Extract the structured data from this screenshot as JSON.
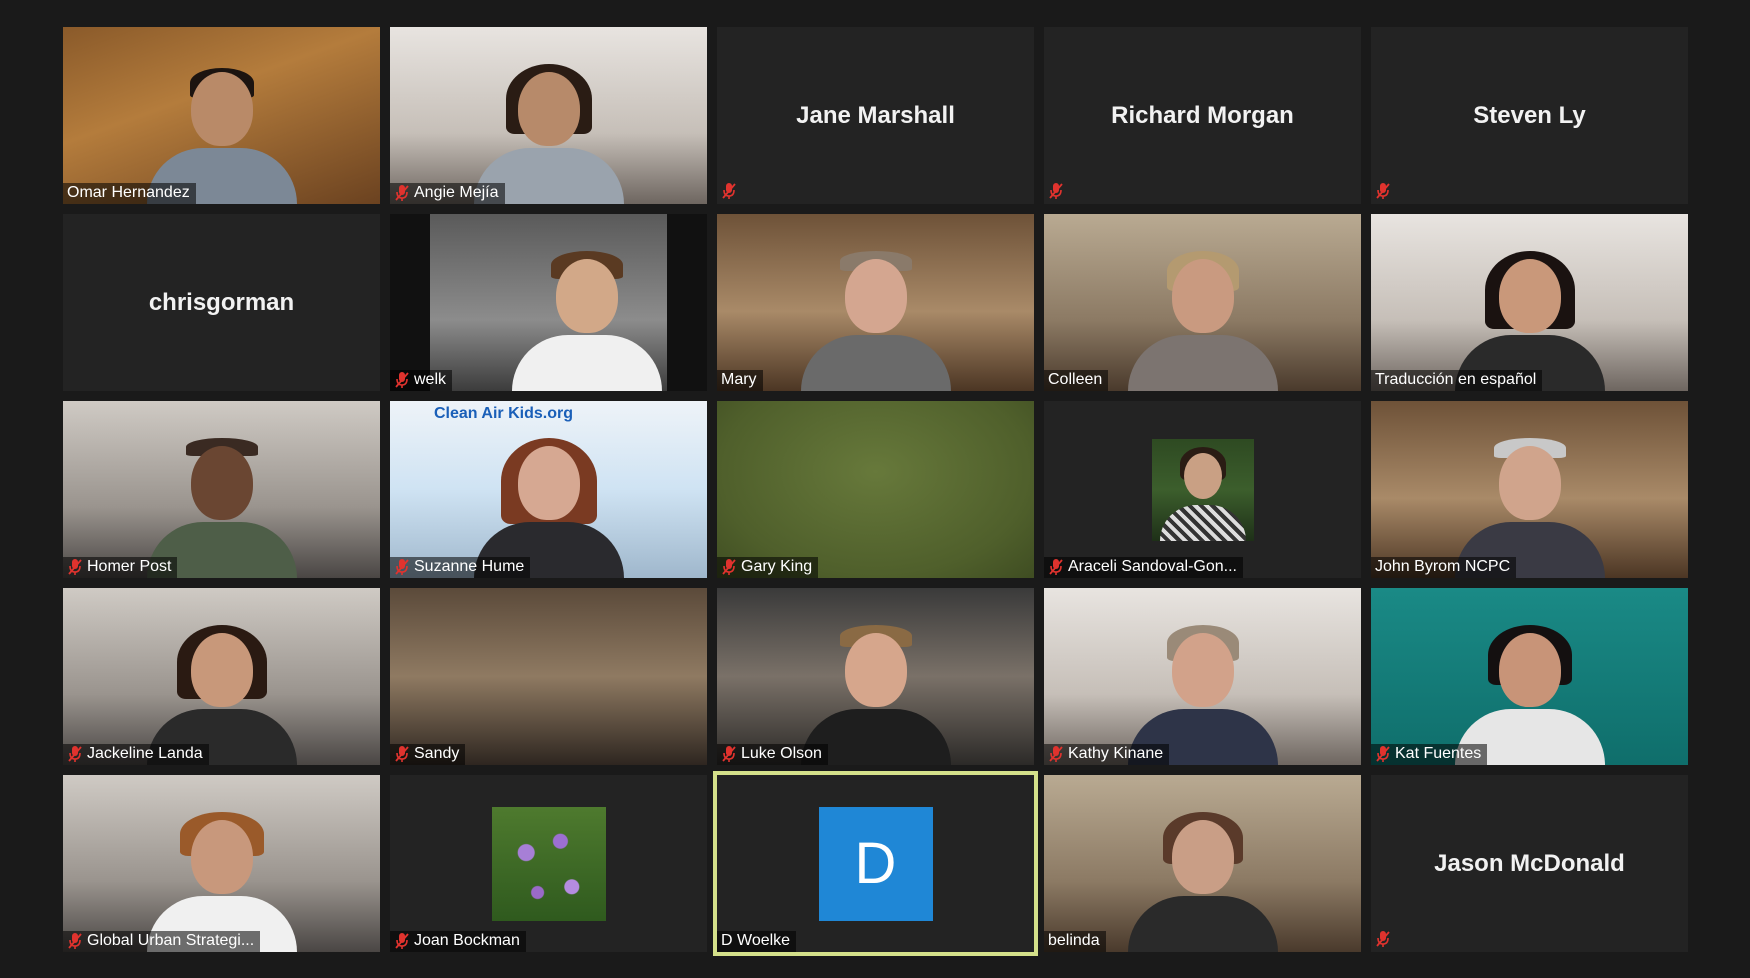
{
  "participants": [
    {
      "name": "Omar Hernandez",
      "muted": false,
      "video": true
    },
    {
      "name": "Angie Mejía",
      "muted": true,
      "video": true
    },
    {
      "name": "Jane Marshall",
      "muted": true,
      "video": false
    },
    {
      "name": "Richard Morgan",
      "muted": true,
      "video": false
    },
    {
      "name": "Steven Ly",
      "muted": true,
      "video": false
    },
    {
      "name": "chrisgorman",
      "muted": false,
      "video": false
    },
    {
      "name": "welk",
      "muted": true,
      "video": true
    },
    {
      "name": "Mary",
      "muted": false,
      "video": true
    },
    {
      "name": "Colleen",
      "muted": false,
      "video": true
    },
    {
      "name": "Traducción en español",
      "muted": false,
      "video": true
    },
    {
      "name": "Homer Post",
      "muted": true,
      "video": true
    },
    {
      "name": "Suzanne Hume",
      "muted": true,
      "video": true
    },
    {
      "name": "Gary King",
      "muted": true,
      "video": true
    },
    {
      "name": "Araceli Sandoval-Gon...",
      "muted": true,
      "video": false
    },
    {
      "name": "John Byrom NCPC",
      "muted": false,
      "video": true
    },
    {
      "name": "Jackeline Landa",
      "muted": true,
      "video": true
    },
    {
      "name": "Sandy",
      "muted": true,
      "video": true
    },
    {
      "name": "Luke Olson",
      "muted": true,
      "video": true
    },
    {
      "name": "Kathy Kinane",
      "muted": true,
      "video": true
    },
    {
      "name": "Kat Fuentes",
      "muted": true,
      "video": true
    },
    {
      "name": "Global Urban Strategi...",
      "muted": true,
      "video": true
    },
    {
      "name": "Joan Bockman",
      "muted": true,
      "video": false
    },
    {
      "name": "D Woelke",
      "muted": false,
      "video": false,
      "initial": "D",
      "active_speaker": true
    },
    {
      "name": "belinda",
      "muted": false,
      "video": true
    },
    {
      "name": "Jason McDonald",
      "muted": true,
      "video": false
    }
  ],
  "poster_text": "Clean Air Kids.org",
  "colors": {
    "background": "#1a1a1a",
    "tile": "#232323",
    "mute_red": "#e0332e",
    "active_border": "#d4e08a",
    "avatar_blue": "#1f87d6"
  },
  "icons": {
    "mute": "mic-muted-icon"
  }
}
